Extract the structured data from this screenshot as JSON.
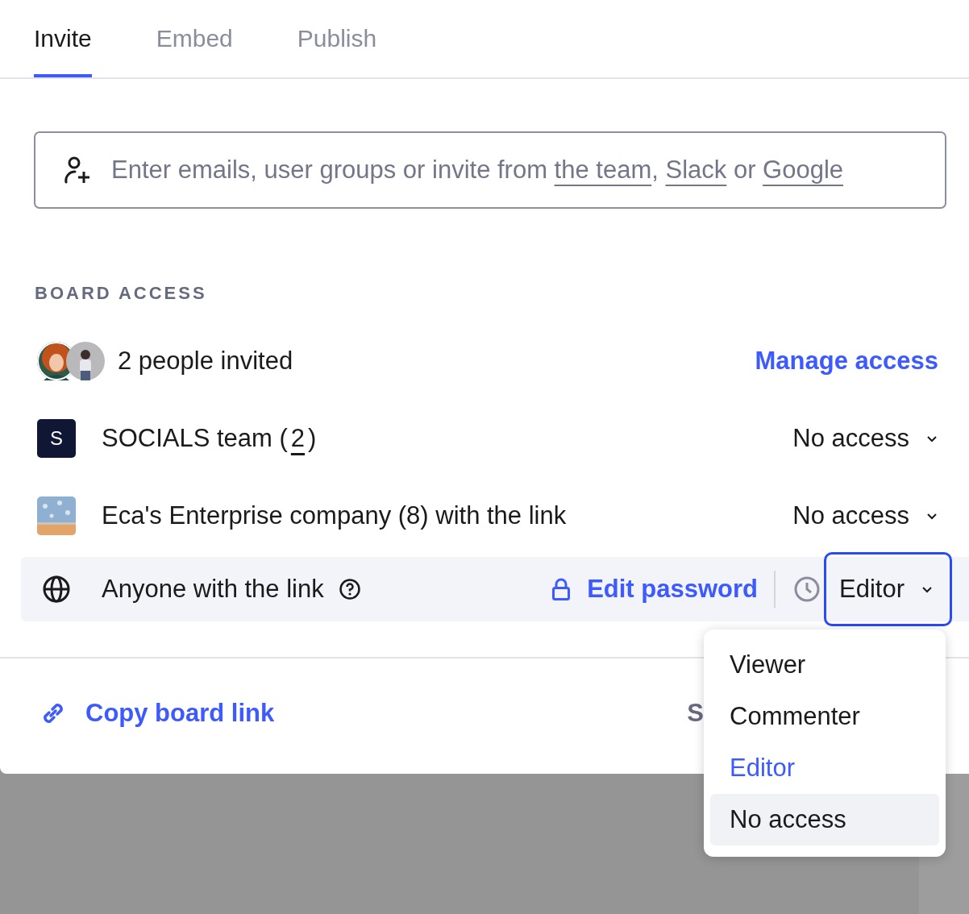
{
  "tabs": [
    {
      "label": "Invite",
      "selected": true
    },
    {
      "label": "Embed",
      "selected": false
    },
    {
      "label": "Publish",
      "selected": false
    }
  ],
  "invite_field": {
    "parts": [
      {
        "kind": "text",
        "text": "Enter emails, user groups or invite from "
      },
      {
        "kind": "link",
        "text": "the team"
      },
      {
        "kind": "text",
        "text": ", "
      },
      {
        "kind": "link",
        "text": "Slack"
      },
      {
        "kind": "text",
        "text": " or "
      },
      {
        "kind": "link",
        "text": "Google"
      }
    ]
  },
  "section_label": "BOARD ACCESS",
  "access_rows": [
    {
      "kind": "people",
      "label": "2 people invited",
      "action": "Manage access"
    },
    {
      "kind": "team",
      "badge": "S",
      "parts": [
        {
          "kind": "text",
          "text": "SOCIALS team ("
        },
        {
          "kind": "link",
          "text": "2"
        },
        {
          "kind": "text",
          "text": ")"
        }
      ],
      "role": "No access"
    },
    {
      "kind": "org",
      "label": "Eca's Enterprise company (8) with the link",
      "role": "No access"
    },
    {
      "kind": "link",
      "label": "Anyone with the link",
      "password": "Edit password",
      "role": "Editor",
      "focused": true
    }
  ],
  "role_menu": {
    "items": [
      {
        "label": "Viewer",
        "selected": false,
        "hovered": false
      },
      {
        "label": "Commenter",
        "selected": false,
        "hovered": false
      },
      {
        "label": "Editor",
        "selected": true,
        "hovered": false
      },
      {
        "label": "No access",
        "selected": false,
        "hovered": true
      }
    ]
  },
  "copy_link": "Copy board link",
  "footer_text": "S"
}
